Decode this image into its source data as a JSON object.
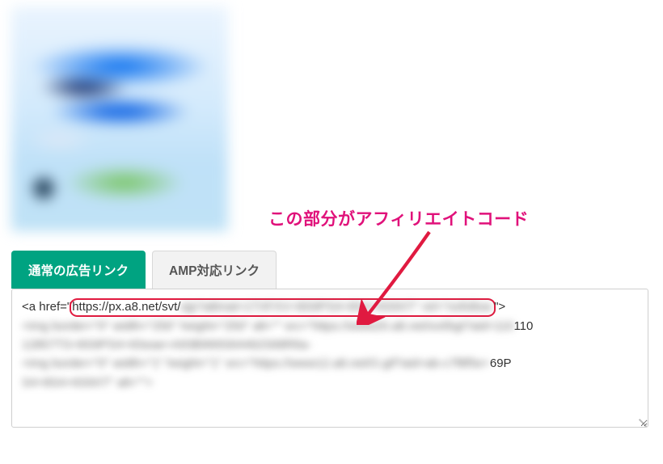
{
  "tabs": {
    "normal": "通常の広告リンク",
    "amp": "AMP対応リンク"
  },
  "annotation": "この部分がアフィリエイトコード",
  "code": {
    "line1_pre": "<a href=\"",
    "line1_url_head": "https://px.a8.net/svt/",
    "line1_url_blur": "ejp?a8mat=1TXFXV+8S9PS4+8S4+6S9XT\" rel=\"nofollow",
    "line1_post": "\">",
    "line2_head": "<img border=\"0\" width=\"250\" height=\"250\" alt=\"\" src=\"https://www20.a8.net/svt/bgt?aid=110",
    "line2_tail_blur": "12857TS+8S9PS4+6Seae+A93B969S64462S68R6a-",
    "line3_blur": "<img border=\"0\" width=\"1\" height=\"1\" src=\"https://www12.a8.net/O.gif?aid=ab-c7f8f5e+",
    "line3_tail": "69P",
    "line4_blur": "S4+8S4+6S9XT\" alt=\"\">"
  }
}
